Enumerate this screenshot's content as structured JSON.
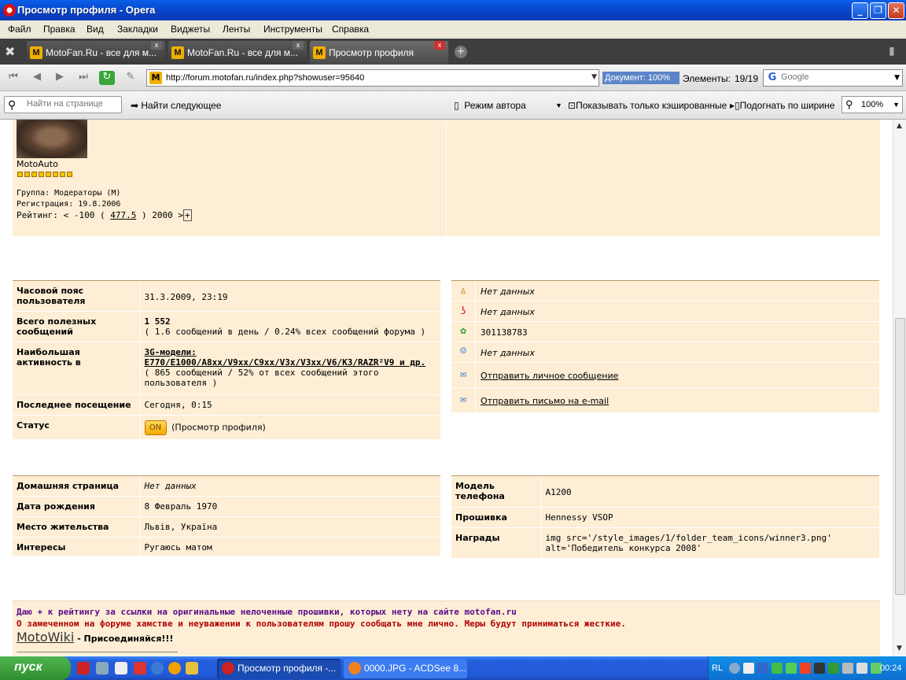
{
  "window": {
    "title": "Просмотр профиля - Opera"
  },
  "menu": [
    "Файл",
    "Правка",
    "Вид",
    "Закладки",
    "Виджеты",
    "Ленты",
    "Инструменты",
    "Справка"
  ],
  "tabs": [
    {
      "label": "MotoFan.Ru - все для м...",
      "active": false
    },
    {
      "label": "MotoFan.Ru - все для м...",
      "active": false
    },
    {
      "label": "Просмотр профиля",
      "active": true
    }
  ],
  "address": {
    "url": "http://forum.motofan.ru/index.php?showuser=95640",
    "doc_progress": "Документ:  100%",
    "elements_label": "Элементы:",
    "elements_value": "19/19",
    "search_placeholder": "Google"
  },
  "findbar": {
    "find_placeholder": "Найти на странице",
    "find_next": "Найти следующее",
    "author_mode": "Режим автора",
    "cached_only": "Показывать только кэшированные",
    "fit_width": "Подогнать по ширине",
    "zoom": "100%"
  },
  "profile": {
    "username": "MotoAuto",
    "group": "Группа: Модераторы (M)",
    "registered": "Регистрация: 19.8.2006",
    "rating_prefix": "Рейтинг: < -100 (",
    "rating_value": "477.5",
    "rating_suffix": ") 2000 >",
    "rating_plus": "+",
    "stars": 8
  },
  "stats": [
    {
      "label": "Часовой пояс пользователя",
      "value": "31.3.2009, 23:19"
    },
    {
      "label": "Всего полезных сообщений",
      "value": "1 552",
      "sub": "( 1.6 сообщений в день / 0.24% всех сообщений форума )"
    },
    {
      "label": "Наибольшая активность в",
      "value": "3G-модели: E770/E1000/A8xx/V9xx/C9xx/V3x/V3xx/V6/K3/RAZR²V9 и др.",
      "sub": "( 865 сообщений / 52% от всех сообщений этого пользователя )"
    },
    {
      "label": "Последнее посещение",
      "value": "Сегодня, 0:15"
    },
    {
      "label": "Статус",
      "badge": "ON",
      "value": "(Просмотр профиля)"
    }
  ],
  "contacts": [
    {
      "icon": "aim-icon",
      "text": "Нет данных"
    },
    {
      "icon": "yahoo-icon",
      "text": "Нет данных"
    },
    {
      "icon": "icq-icon",
      "text": "301138783"
    },
    {
      "icon": "msn-icon",
      "text": "Нет данных"
    },
    {
      "icon": "envelope-icon",
      "text": "Отправить личное сообщение"
    },
    {
      "icon": "envelope-icon",
      "text": "Отправить письмо на e-mail"
    }
  ],
  "personal": [
    {
      "label": "Домашняя страница",
      "value": "Нет данных"
    },
    {
      "label": "Дата рождения",
      "value": "8 Февраль 1970"
    },
    {
      "label": "Место жительства",
      "value": "Львів, Україна"
    },
    {
      "label": "Интересы",
      "value": "Ругаюсь матом"
    }
  ],
  "phone": [
    {
      "label": "Модель телефона",
      "value": "A1200"
    },
    {
      "label": "Прошивка",
      "value": "Hennessy VSOP"
    },
    {
      "label": "Награды",
      "value": "img src='/style_images/1/folder_team_icons/winner3.png' alt='Победитель конкурса 2008'"
    }
  ],
  "signature": {
    "line1": "Даю + к рейтингу за ссылки на оригинальные нелоченные прошивки, которых нету на сайте motofan.ru",
    "line2": "О замеченном на форуме хамстве и неуважении к пользователям прошу сообщать мне лично. Меры будут приниматься жесткие.",
    "wiki_link": "MotoWiki",
    "wiki_text": " - Присоединяйся!!!"
  },
  "taskbar": {
    "start": "пуск",
    "items": [
      "Просмотр профиля -...",
      "0000.JPG - ACDSee 8..."
    ],
    "lang": "RL",
    "clock": "00:24"
  },
  "colors": {
    "panel": "#fdeed5",
    "sig_purple": "#5a0a8a",
    "sig_red": "#b00000"
  }
}
